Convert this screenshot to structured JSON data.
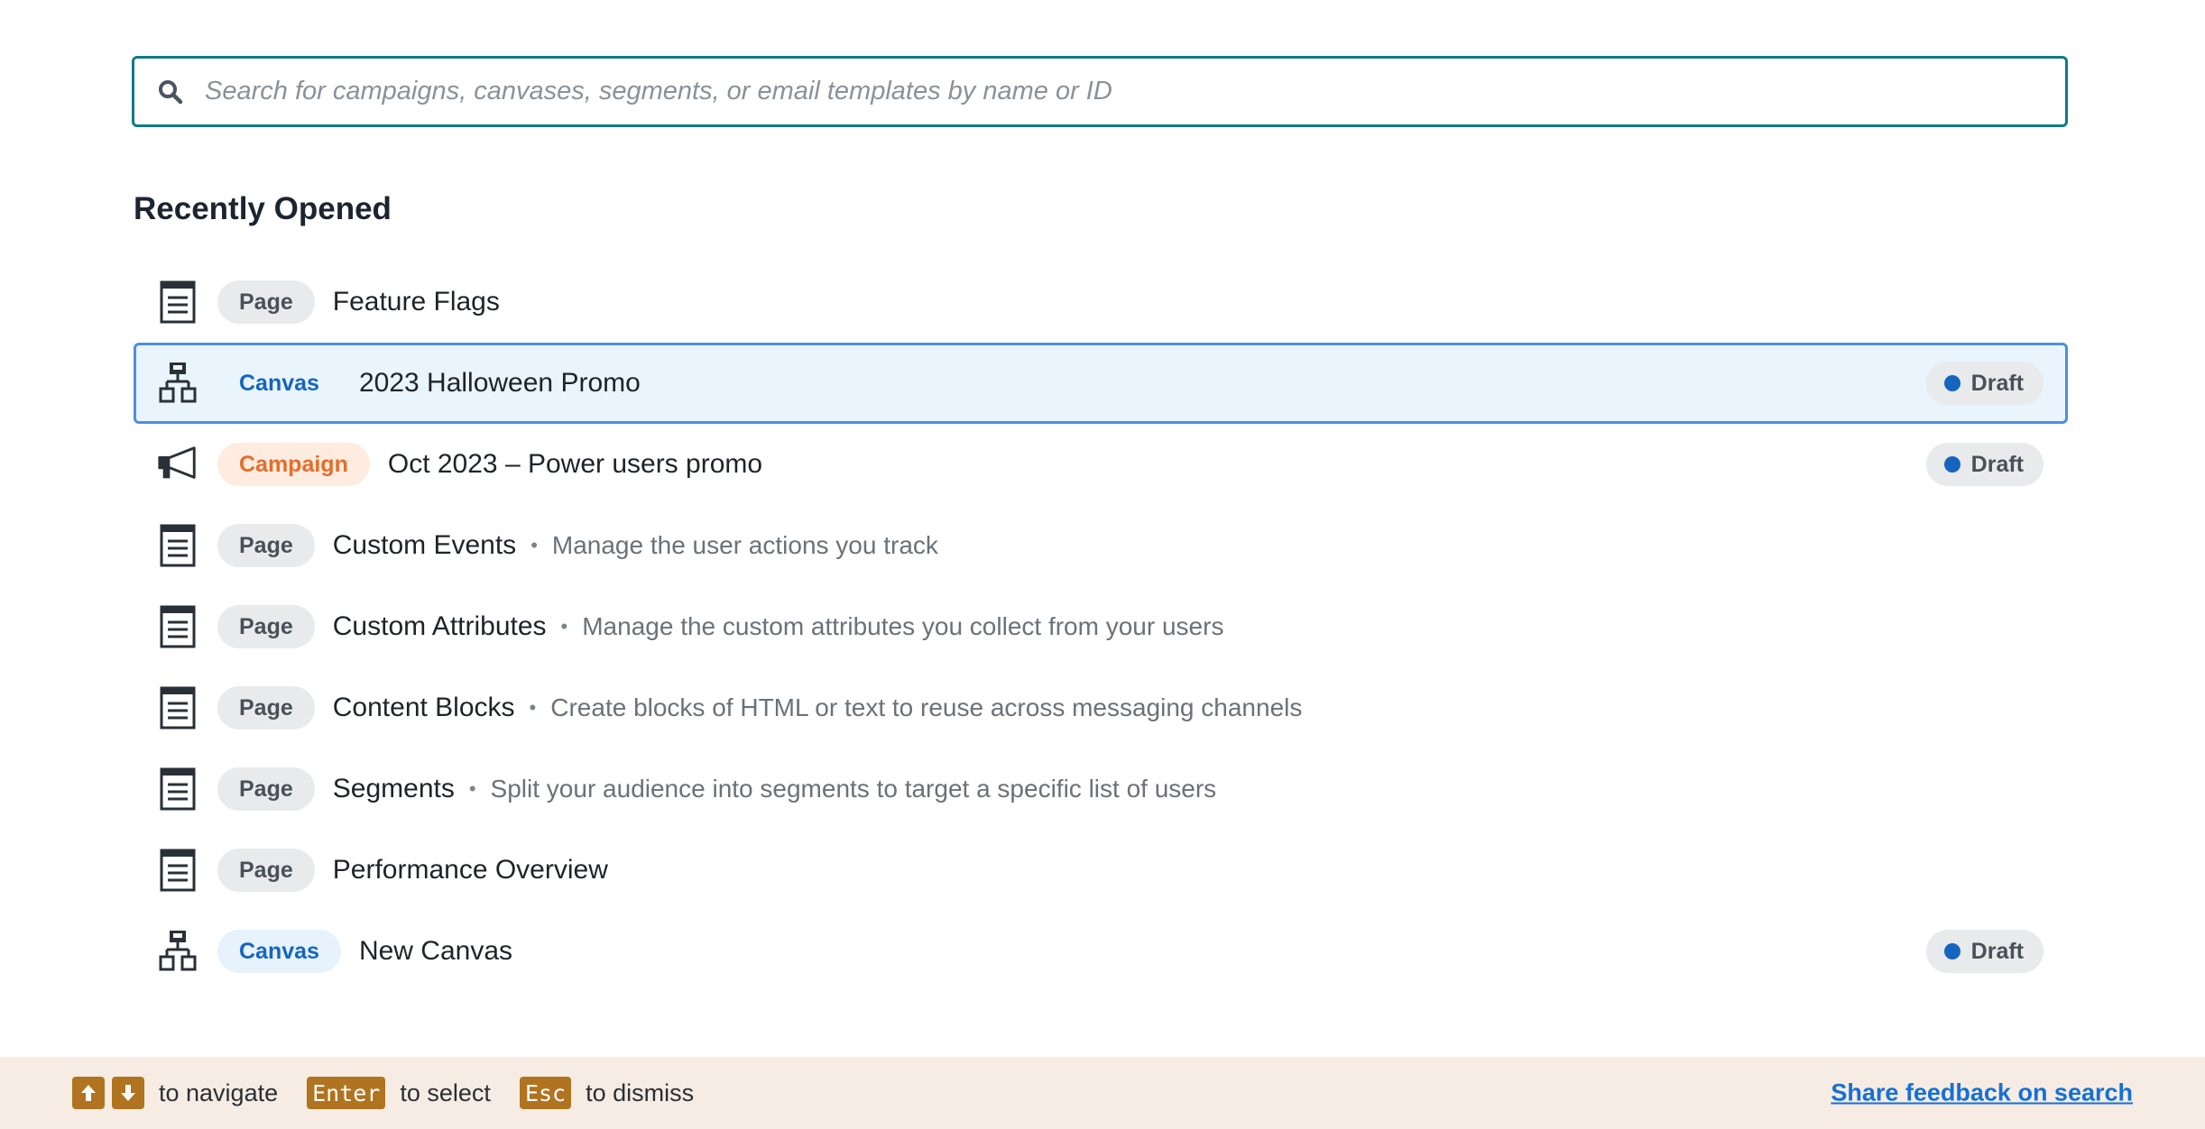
{
  "search": {
    "placeholder": "Search for campaigns, canvases, segments, or email templates by name or ID",
    "value": ""
  },
  "recent": {
    "heading": "Recently Opened",
    "items": [
      {
        "type": "page",
        "badge": "Page",
        "title": "Feature Flags",
        "description": "",
        "status": ""
      },
      {
        "type": "canvas",
        "badge": "Canvas",
        "title": "2023 Halloween Promo",
        "description": "",
        "status": "Draft",
        "selected": true
      },
      {
        "type": "campaign",
        "badge": "Campaign",
        "title": "Oct 2023 – Power users promo",
        "description": "",
        "status": "Draft"
      },
      {
        "type": "page",
        "badge": "Page",
        "title": "Custom Events",
        "description": "Manage the user actions you track",
        "status": ""
      },
      {
        "type": "page",
        "badge": "Page",
        "title": "Custom Attributes",
        "description": "Manage the custom attributes you collect from your users",
        "status": ""
      },
      {
        "type": "page",
        "badge": "Page",
        "title": "Content Blocks",
        "description": "Create blocks of HTML or text to reuse across messaging channels",
        "status": ""
      },
      {
        "type": "page",
        "badge": "Page",
        "title": "Segments",
        "description": "Split your audience into segments to target a specific list of users",
        "status": ""
      },
      {
        "type": "page",
        "badge": "Page",
        "title": "Performance Overview",
        "description": "",
        "status": ""
      },
      {
        "type": "canvas",
        "badge": "Canvas",
        "title": "New Canvas",
        "description": "",
        "status": "Draft"
      }
    ]
  },
  "footer": {
    "up_key": "↑",
    "down_key": "↓",
    "navigate_label": "to navigate",
    "enter_key": "Enter",
    "select_label": "to select",
    "esc_key": "Esc",
    "dismiss_label": "to dismiss",
    "feedback_link": "Share feedback on search"
  },
  "colors": {
    "search_border": "#0e7c86",
    "selected_bg": "#eaf4fd",
    "selected_border": "#4a90e2",
    "canvas_badge": "#1565c0",
    "campaign_badge": "#e56d2a",
    "draft_dot": "#1565c0",
    "footer_bg": "#f6ece3",
    "key_bg": "#b0731f",
    "link": "#1570d6"
  },
  "icons": {
    "search": "search-icon",
    "page": "page-icon",
    "canvas": "canvas-icon",
    "campaign": "megaphone-icon"
  }
}
